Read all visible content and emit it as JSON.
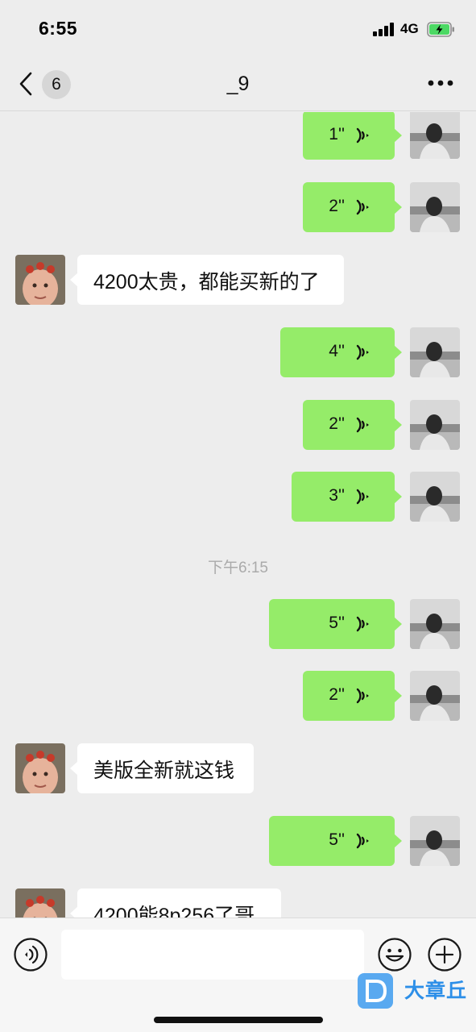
{
  "status_bar": {
    "time": "6:55",
    "network": "4G"
  },
  "nav": {
    "unread_count": "6",
    "title": "_9"
  },
  "messages": [
    {
      "side": "right",
      "type": "voice",
      "duration": "1''"
    },
    {
      "side": "right",
      "type": "voice",
      "duration": "2''"
    },
    {
      "side": "left",
      "type": "text",
      "text": "4200太贵，都能买新的了"
    },
    {
      "side": "right",
      "type": "voice",
      "duration": "4''"
    },
    {
      "side": "right",
      "type": "voice",
      "duration": "2''"
    },
    {
      "side": "right",
      "type": "voice",
      "duration": "3''"
    },
    {
      "type": "timestamp",
      "text": "下午6:15"
    },
    {
      "side": "right",
      "type": "voice",
      "duration": "5''"
    },
    {
      "side": "right",
      "type": "voice",
      "duration": "2''"
    },
    {
      "side": "left",
      "type": "text",
      "text": "美版全新就这钱"
    },
    {
      "side": "right",
      "type": "voice",
      "duration": "5''"
    },
    {
      "side": "left",
      "type": "text",
      "text": "4200能8p256了哥"
    }
  ],
  "input": {
    "placeholder": ""
  },
  "watermark": {
    "text": "大章丘"
  },
  "colors": {
    "sent_bubble": "#95ec69",
    "received_bubble": "#ffffff",
    "background": "#ededed"
  }
}
